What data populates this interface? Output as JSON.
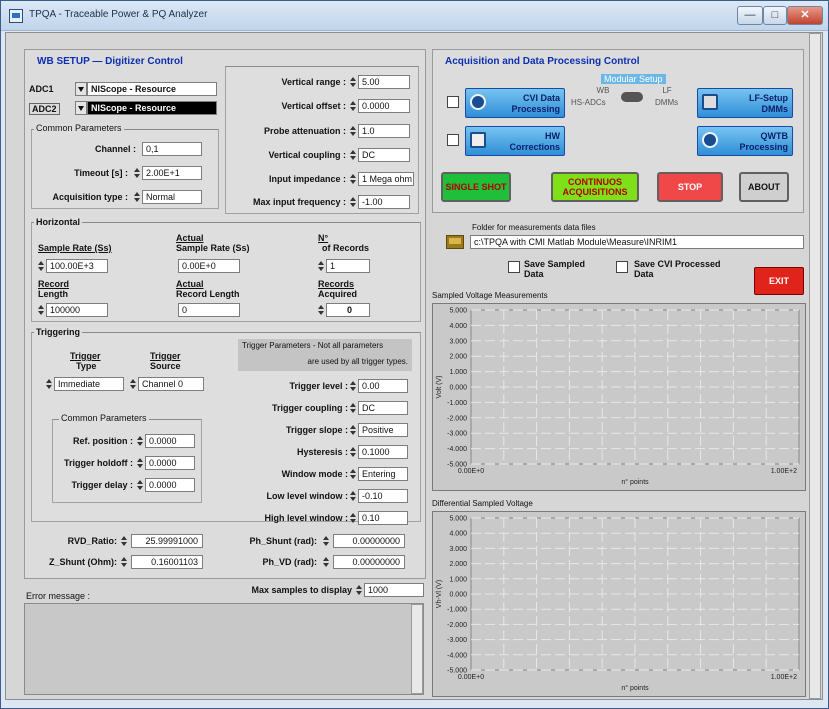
{
  "window": {
    "title": "TPQA - Traceable Power & PQ Analyzer",
    "controls": {
      "minimize": "—",
      "maximize": "□",
      "close": "✕"
    }
  },
  "wb_setup": {
    "title": "WB SETUP — Digitizer Control",
    "adc1_label": "ADC1",
    "adc1_value": "NIScope - Resource",
    "adc2_label": "ADC2",
    "adc2_value": "NIScope - Resource",
    "common_params_title": "Common Parameters",
    "channel_label": "Channel :",
    "channel_value": "0,1",
    "timeout_label": "Timeout [s] :",
    "timeout_value": "2.00E+1",
    "acq_type_label": "Acquisition type :",
    "acq_type_value": "Normal",
    "vertical_range_label": "Vertical range :",
    "vertical_range_value": "5.00",
    "vertical_offset_label": "Vertical offset :",
    "vertical_offset_value": "0.0000",
    "probe_atten_label": "Probe attenuation :",
    "probe_atten_value": "1.0",
    "vertical_coupling_label": "Vertical coupling :",
    "vertical_coupling_value": "DC",
    "input_impedance_label": "Input impedance :",
    "input_impedance_value": "1 Mega ohm",
    "max_input_freq_label": "Max input frequency :",
    "max_input_freq_value": "-1.00"
  },
  "horizontal": {
    "title": "Horizontal",
    "sample_rate_label": "Sample Rate (Ss)",
    "sample_rate_value": "100.00E+3",
    "actual_sample_rate_label_1": "Actual",
    "actual_sample_rate_label_2": "Sample Rate (Ss)",
    "actual_sample_rate_value": "0.00E+0",
    "n_records_label_1": "N°",
    "n_records_label_2": "of Records",
    "n_records_value": "1",
    "record_length_label_1": "Record",
    "record_length_label_2": "Length",
    "record_length_value": "100000",
    "actual_record_length_label_1": "Actual",
    "actual_record_length_label_2": "Record Length",
    "actual_record_length_value": "0",
    "records_acquired_label_1": "Records",
    "records_acquired_label_2": "Acquired",
    "records_acquired_value": "0"
  },
  "triggering": {
    "title": "Triggering",
    "trigger_type_label_1": "Trigger",
    "trigger_type_label_2": "Type",
    "trigger_type_value": "Immediate",
    "trigger_source_label_1": "Trigger",
    "trigger_source_label_2": "Source",
    "trigger_source_value": "Channel 0",
    "params_note_1": "Trigger Parameters - Not all parameters",
    "params_note_2": "are used by all trigger types.",
    "trigger_level_label": "Trigger level :",
    "trigger_level_value": "0.00",
    "trigger_coupling_label": "Trigger coupling :",
    "trigger_coupling_value": "DC",
    "trigger_slope_label": "Trigger slope :",
    "trigger_slope_value": "Positive",
    "hysteresis_label": "Hysteresis :",
    "hysteresis_value": "0.1000",
    "window_mode_label": "Window mode :",
    "window_mode_value": "Entering",
    "low_level_window_label": "Low level window :",
    "low_level_window_value": "-0.10",
    "high_level_window_label": "High level window :",
    "high_level_window_value": "0.10",
    "common_params_title": "Common Parameters",
    "ref_position_label": "Ref. position :",
    "ref_position_value": "0.0000",
    "trigger_holdoff_label": "Trigger holdoff :",
    "trigger_holdoff_value": "0.0000",
    "trigger_delay_label": "Trigger delay :",
    "trigger_delay_value": "0.0000"
  },
  "ratios": {
    "rvd_ratio_label": "RVD_Ratio:",
    "rvd_ratio_value": "25.99991000",
    "z_shunt_label": "Z_Shunt (Ohm):",
    "z_shunt_value": "0.16001103",
    "ph_shunt_label": "Ph_Shunt (rad):",
    "ph_shunt_value": "0.00000000",
    "ph_vd_label": "Ph_VD (rad):",
    "ph_vd_value": "0.00000000"
  },
  "bottom": {
    "max_samples_label": "Max samples to display",
    "max_samples_value": "1000",
    "error_message_label": "Error message :"
  },
  "acq_control": {
    "title": "Acquisition and Data Processing Control",
    "modular_setup": "Modular Setup",
    "cvi_data_processing": "CVI Data Processing",
    "hw_corrections": "HW Corrections",
    "wb_label": "WB",
    "hs_adcs_label": "HS-ADCs",
    "lf_label": "LF",
    "dmms_label": "DMMs",
    "lf_setup_dmms": "LF-Setup DMMs",
    "qwtb_processing": "QWTB Processing",
    "single_shot": "SINGLE SHOT",
    "continuous_acquisitions": "CONTINUOS ACQUISITIONS",
    "stop": "STOP",
    "about": "ABOUT",
    "folder_label": "Folder for measurements data files",
    "folder_value": "c:\\TPQA with CMI Matlab Module\\Measure\\INRIM1",
    "save_sampled_data": "Save Sampled Data",
    "save_cvi_processed_data": "Save CVI Processed Data",
    "exit": "EXIT"
  },
  "colors": {
    "single_shot": "#1fbf3a",
    "continuous": "#7fe01a",
    "stop": "#f04848",
    "about": "#cfcfcf",
    "exit": "#e0231b",
    "accent_blue": "#2f8fd6"
  },
  "chart_data": [
    {
      "type": "line",
      "title": "Sampled Voltage Measurements",
      "xlabel": "n° points",
      "ylabel": "Volt (V)",
      "x_ticks": [
        "0.00E+0",
        "1.00E+2"
      ],
      "y_ticks": [
        "5.000",
        "4.000",
        "3.000",
        "2.000",
        "1.000",
        "0.000",
        "-1.000",
        "-2.000",
        "-3.000",
        "-4.000",
        "-5.000"
      ],
      "ylim": [
        -5,
        5
      ],
      "xlim": [
        0,
        100
      ],
      "grid": true,
      "series": []
    },
    {
      "type": "line",
      "title": "Differential Sampled Voltage",
      "xlabel": "n° points",
      "ylabel": "Vh-Vl (V)",
      "x_ticks": [
        "0.00E+0",
        "1.00E+2"
      ],
      "y_ticks": [
        "5.000",
        "4.000",
        "3.000",
        "2.000",
        "1.000",
        "0.000",
        "-1.000",
        "-2.000",
        "-3.000",
        "-4.000",
        "-5.000"
      ],
      "ylim": [
        -5,
        5
      ],
      "xlim": [
        0,
        100
      ],
      "grid": true,
      "series": []
    }
  ]
}
